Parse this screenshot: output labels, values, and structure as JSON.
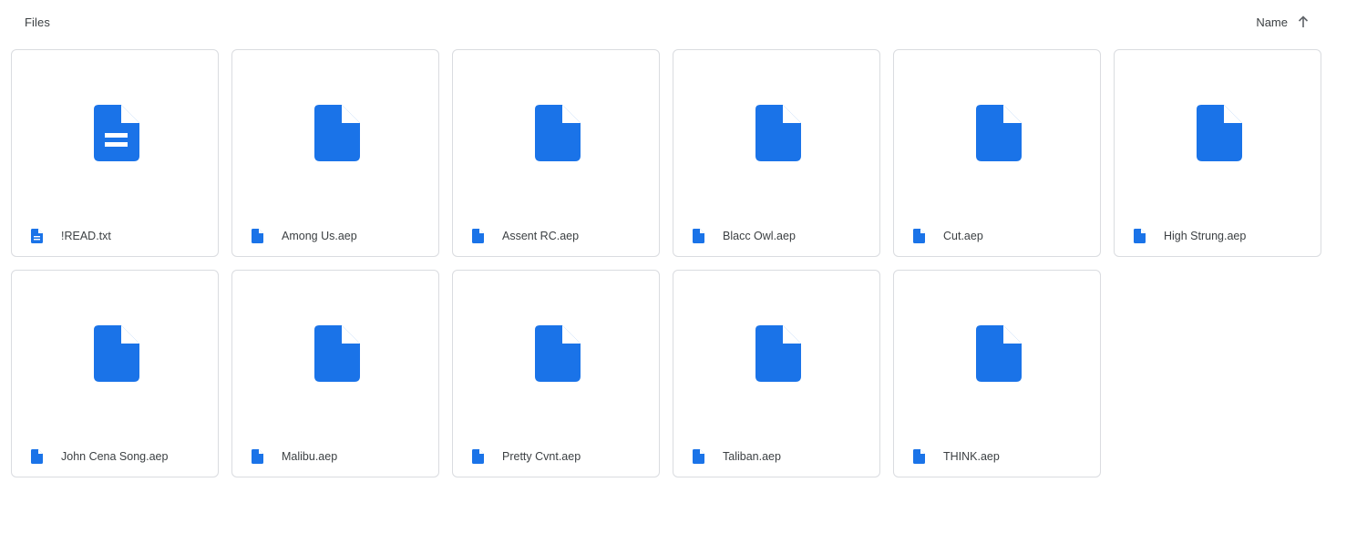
{
  "section_title": "Files",
  "sort": {
    "label": "Name",
    "direction_icon": "arrow-up-icon"
  },
  "accent_color": "#1a73e8",
  "files": [
    {
      "name": "!READ.txt",
      "kind": "document"
    },
    {
      "name": "Among Us.aep",
      "kind": "file"
    },
    {
      "name": "Assent RC.aep",
      "kind": "file"
    },
    {
      "name": "Blacc Owl.aep",
      "kind": "file"
    },
    {
      "name": "Cut.aep",
      "kind": "file"
    },
    {
      "name": "High Strung.aep",
      "kind": "file"
    },
    {
      "name": "John Cena Song.aep",
      "kind": "file"
    },
    {
      "name": "Malibu.aep",
      "kind": "file"
    },
    {
      "name": "Pretty Cvnt.aep",
      "kind": "file"
    },
    {
      "name": "Taliban.aep",
      "kind": "file"
    },
    {
      "name": "THINK.aep",
      "kind": "file"
    }
  ]
}
